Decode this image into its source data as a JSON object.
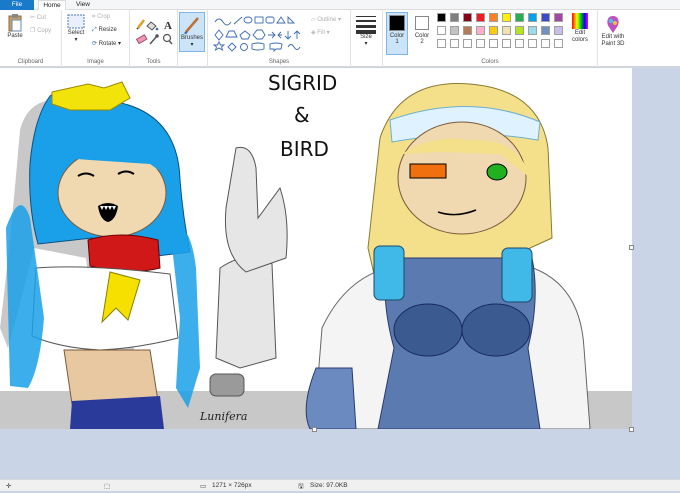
{
  "tabs": {
    "file": "File",
    "home": "Home",
    "view": "View"
  },
  "clipboard": {
    "paste": "Paste",
    "cut": "Cut",
    "copy": "Copy",
    "label": "Clipboard"
  },
  "image": {
    "select": "Select",
    "crop": "Crop",
    "resize": "Resize",
    "rotate": "Rotate",
    "label": "Image"
  },
  "tools": {
    "label": "Tools",
    "brushes": "Brushes"
  },
  "shapes": {
    "outline": "Outline",
    "fill": "Fill",
    "label": "Shapes"
  },
  "size": {
    "label": "Size"
  },
  "colors": {
    "color1_label": "Color",
    "color1_num": "1",
    "color2_label": "Color",
    "color2_num": "2",
    "label": "Colors",
    "edit_colors": "Edit colors",
    "edit_paint3d": "Edit with Paint 3D",
    "color1": "#000000",
    "color2": "#ffffff",
    "palette_row1": [
      "#000000",
      "#7f7f7f",
      "#880015",
      "#ed1c24",
      "#ff7f27",
      "#fff200",
      "#22b14c",
      "#00a2e8",
      "#3f48cc",
      "#a349a4"
    ],
    "palette_row2": [
      "#ffffff",
      "#c3c3c3",
      "#b97a57",
      "#ffaeC9",
      "#ffc90e",
      "#efe4b0",
      "#b5e61d",
      "#99d9ea",
      "#7092be",
      "#c8bfe7"
    ]
  },
  "drawing": {
    "title_line1": "SIGRID",
    "title_line2": "&",
    "title_line3": "BIRD",
    "signature": "Lunifera"
  },
  "status": {
    "dimensions": "1271 × 726px",
    "size": "Size: 97.0KB"
  }
}
